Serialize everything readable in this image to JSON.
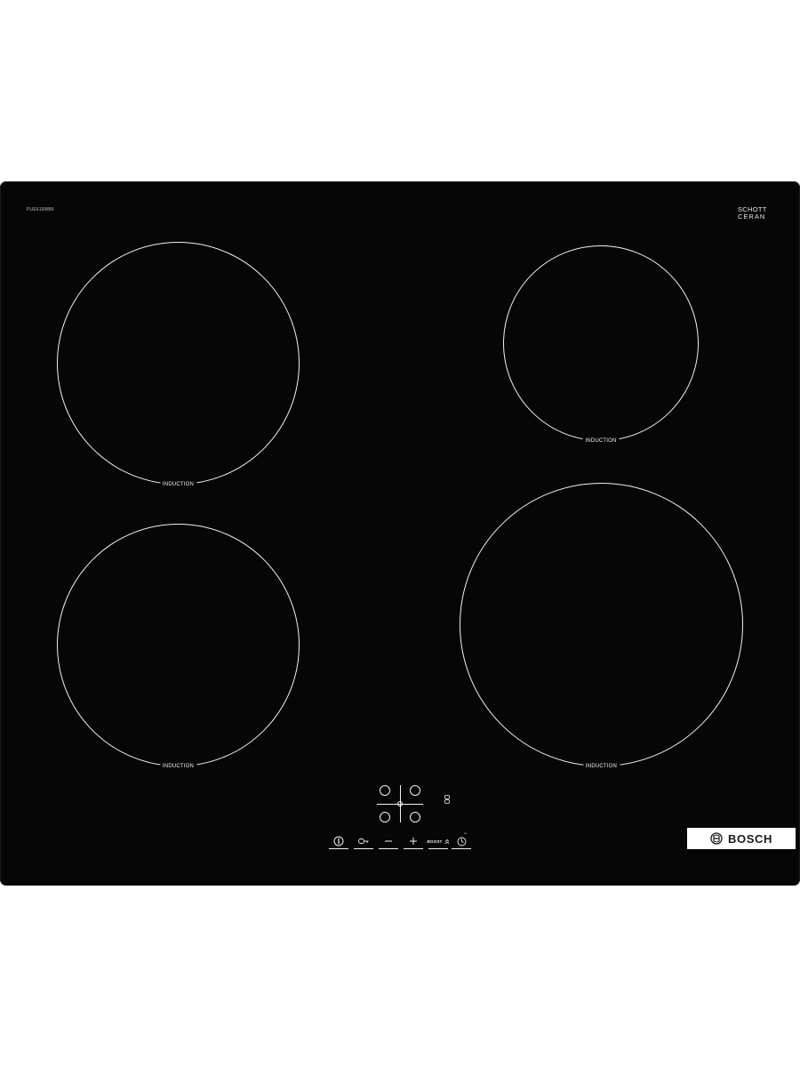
{
  "product": {
    "model": "PUE61RBB6",
    "glass_brand_line1": "SCHOTT",
    "glass_brand_line2": "CERAN",
    "glass_brand_sub": "",
    "brand": "BOSCH",
    "colors": {
      "surface": "#060606",
      "markings": "#f2f2f2",
      "background": "#ffffff",
      "badge": "#ffffff"
    }
  },
  "zones": [
    {
      "id": "rear-left",
      "label": "INDUCTION"
    },
    {
      "id": "rear-right",
      "label": "INDUCTION"
    },
    {
      "id": "front-left",
      "label": "INDUCTION"
    },
    {
      "id": "front-right",
      "label": "INDUCTION"
    }
  ],
  "controls": {
    "items": [
      {
        "id": "power",
        "icon": "power-icon"
      },
      {
        "id": "child-lock",
        "icon": "key-icon"
      },
      {
        "id": "minus",
        "icon": "minus-icon"
      },
      {
        "id": "plus",
        "icon": "plus-icon"
      },
      {
        "id": "boost",
        "label": "BOOST",
        "icon": "boost-chevron-icon"
      },
      {
        "id": "timer",
        "icon": "timer-icon"
      }
    ],
    "zone_selector_icon": "zone-selector-icon",
    "lock_indicator_icon": "lock-indicator-icon"
  }
}
